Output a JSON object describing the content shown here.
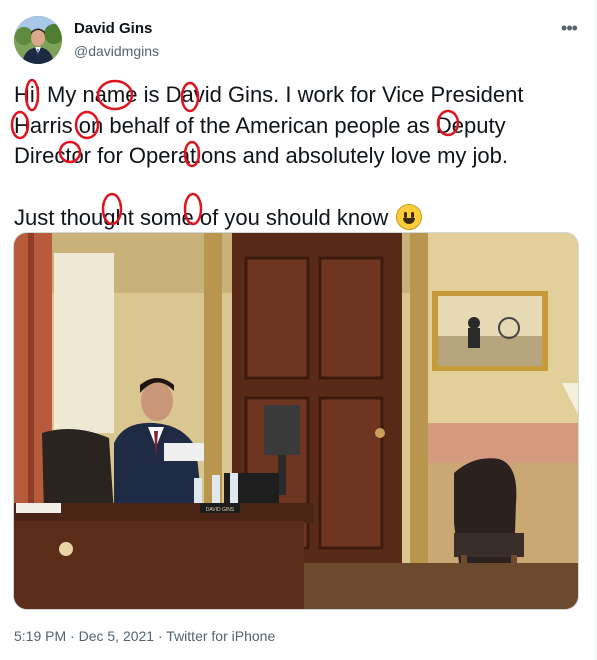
{
  "author": {
    "display_name": "David Gins",
    "handle": "@davidmgins"
  },
  "more_icon": "more-horizontal-icon",
  "tweet": {
    "line_1": "Hi! My name is David Gins. I work for Vice President",
    "line_2": "Harris on behalf of the American people as Deputy",
    "line_3": "Director for Operations and absolutely love my job.",
    "line_4": "Just thought some of you should know",
    "emoji": "grinning-face"
  },
  "annotation_color": "#e0141e",
  "photo": {
    "nameplate": "DAVID GINS"
  },
  "meta": {
    "time": "5:19 PM",
    "sep": " · ",
    "date": "Dec 5, 2021",
    "source": "Twitter for iPhone"
  }
}
